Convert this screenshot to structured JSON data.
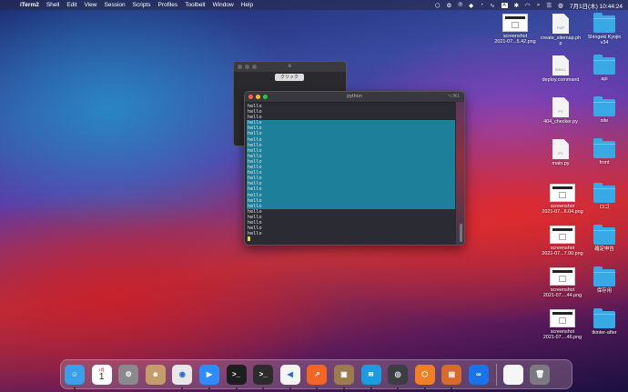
{
  "menubar": {
    "app": "iTerm2",
    "items": [
      "Shell",
      "Edit",
      "View",
      "Session",
      "Scripts",
      "Profiles",
      "Toolbelt",
      "Window",
      "Help"
    ],
    "status": {
      "datetime": "7月1日(木) 10:44:24",
      "a_badge": "A"
    }
  },
  "desktop": {
    "icons": [
      {
        "name": "screenshot-thumb-1",
        "type": "thumb",
        "label": "screenshot\n2021-07...5.42.png"
      },
      {
        "name": "create-sitemap-file",
        "type": "file",
        "ext": "PHP",
        "label": "create_sitemap.ph\np"
      },
      {
        "name": "shingeki-folder",
        "type": "folder",
        "label": "Shingeki Kyojin\nv34"
      },
      {
        "name": "deploy-command-file",
        "type": "file",
        "ext": "SHELL",
        "label": "deploy.command"
      },
      {
        "name": "api-folder",
        "type": "folder",
        "label": "api"
      },
      {
        "name": "404-checker-file",
        "type": "file",
        "ext": "PY",
        "label": "404_checker.py"
      },
      {
        "name": "site-folder",
        "type": "folder",
        "label": "site"
      },
      {
        "name": "main-py-file",
        "type": "file",
        "ext": "PY",
        "label": "main.py"
      },
      {
        "name": "front-folder",
        "type": "folder",
        "label": "front"
      },
      {
        "name": "screenshot-thumb-2",
        "type": "thumb",
        "label": "screenshot\n2021-07...6.04.png"
      },
      {
        "name": "logo-folder",
        "type": "folder",
        "label": "ロゴ"
      },
      {
        "name": "screenshot-thumb-3",
        "type": "thumb",
        "label": "screenshot\n2021-07...7.00.png"
      },
      {
        "name": "tax-folder",
        "type": "folder",
        "label": "確定申告"
      },
      {
        "name": "screenshot-thumb-4",
        "type": "thumb",
        "label": "screenshot\n2021-07....44.png"
      },
      {
        "name": "storage-folder",
        "type": "folder",
        "label": "保存用"
      },
      {
        "name": "screenshot-thumb-5",
        "type": "thumb",
        "label": "screenshot\n2021-07....46.png"
      },
      {
        "name": "tkinter-after-folder",
        "type": "folder",
        "label": "tkinter-after"
      }
    ]
  },
  "tk_window": {
    "title": "tk",
    "button_label": "クリック"
  },
  "terminal": {
    "title": "python",
    "shortcut": "⌥⌘1",
    "lines": [
      "hello",
      "hello",
      "hello",
      "hello",
      "hello",
      "hello",
      "hello",
      "hello",
      "hello",
      "hello",
      "hello",
      "hello",
      "hello",
      "hello",
      "hello",
      "hello",
      "hello",
      "hello",
      "hello",
      "hello",
      "hello",
      "hello",
      "hello",
      "hello"
    ],
    "selected_from": 3,
    "selected_to": 18
  },
  "dock": {
    "calendar_month": "7月",
    "calendar_day": "1",
    "apps": [
      {
        "name": "finder-icon",
        "color": "#3a9ee8",
        "glyph": "☺"
      },
      {
        "name": "calendar-icon",
        "color": "#ffffff",
        "glyph": ""
      },
      {
        "name": "system-preferences-icon",
        "color": "#8a8a8e",
        "glyph": "⚙"
      },
      {
        "name": "contacts-icon",
        "color": "#c69c6d",
        "glyph": "☻"
      },
      {
        "name": "chrome-icon",
        "color": "#e8e8e8",
        "glyph": "◉"
      },
      {
        "name": "zoom-icon",
        "color": "#2d8cff",
        "glyph": "▶"
      },
      {
        "name": "terminal-icon",
        "color": "#1e1e1e",
        "glyph": ">_"
      },
      {
        "name": "iterm-icon",
        "color": "#2c2c2c",
        "glyph": ">_"
      },
      {
        "name": "vscode-icon",
        "color": "#f4f4f4",
        "glyph": "◀"
      },
      {
        "name": "analytics-icon",
        "color": "#f26522",
        "glyph": "↗"
      },
      {
        "name": "archive-icon",
        "color": "#9c7b4f",
        "glyph": "▣"
      },
      {
        "name": "docker-icon",
        "color": "#1d9be0",
        "glyph": "≋"
      },
      {
        "name": "quicktime-icon",
        "color": "#3d3d46",
        "glyph": "◎"
      },
      {
        "name": "diagram-icon",
        "color": "#f08025",
        "glyph": "⬡"
      },
      {
        "name": "preview-icon",
        "color": "#d76b2e",
        "glyph": "▤"
      },
      {
        "name": "loop-icon",
        "color": "#1a73e8",
        "glyph": "∞"
      },
      {
        "name": "document-icon",
        "color": "#f6f6f6",
        "glyph": ""
      },
      {
        "name": "trash-icon",
        "color": "#7a7a80",
        "glyph": "🗑"
      }
    ]
  }
}
